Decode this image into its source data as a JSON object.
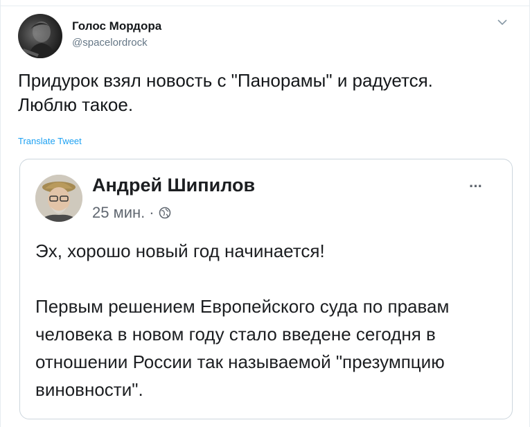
{
  "tweet": {
    "author_name": "Голос Мордора",
    "author_handle": "@spacelordrock",
    "text": "Придурок взял новость с \"Панорамы\" и радуется.\nЛюблю такое.",
    "translate_label": "Translate Tweet",
    "menu_icon": "chevron-down-icon"
  },
  "quoted_post": {
    "author_name": "Андрей Шипилов",
    "time": "25 мин.",
    "separator": "·",
    "privacy_icon": "globe-icon",
    "more_label": "···",
    "paragraphs": [
      "Эх, хорошо новый год начинается!",
      "Первым решением Европейского суда по правам человека в новом году стало введене сегодня в отношении России так называемой \"презумпцию виновности\"."
    ]
  },
  "colors": {
    "link": "#1da1f2",
    "handle": "#657786",
    "border": "#ccd6dd",
    "text": "#14171a"
  }
}
